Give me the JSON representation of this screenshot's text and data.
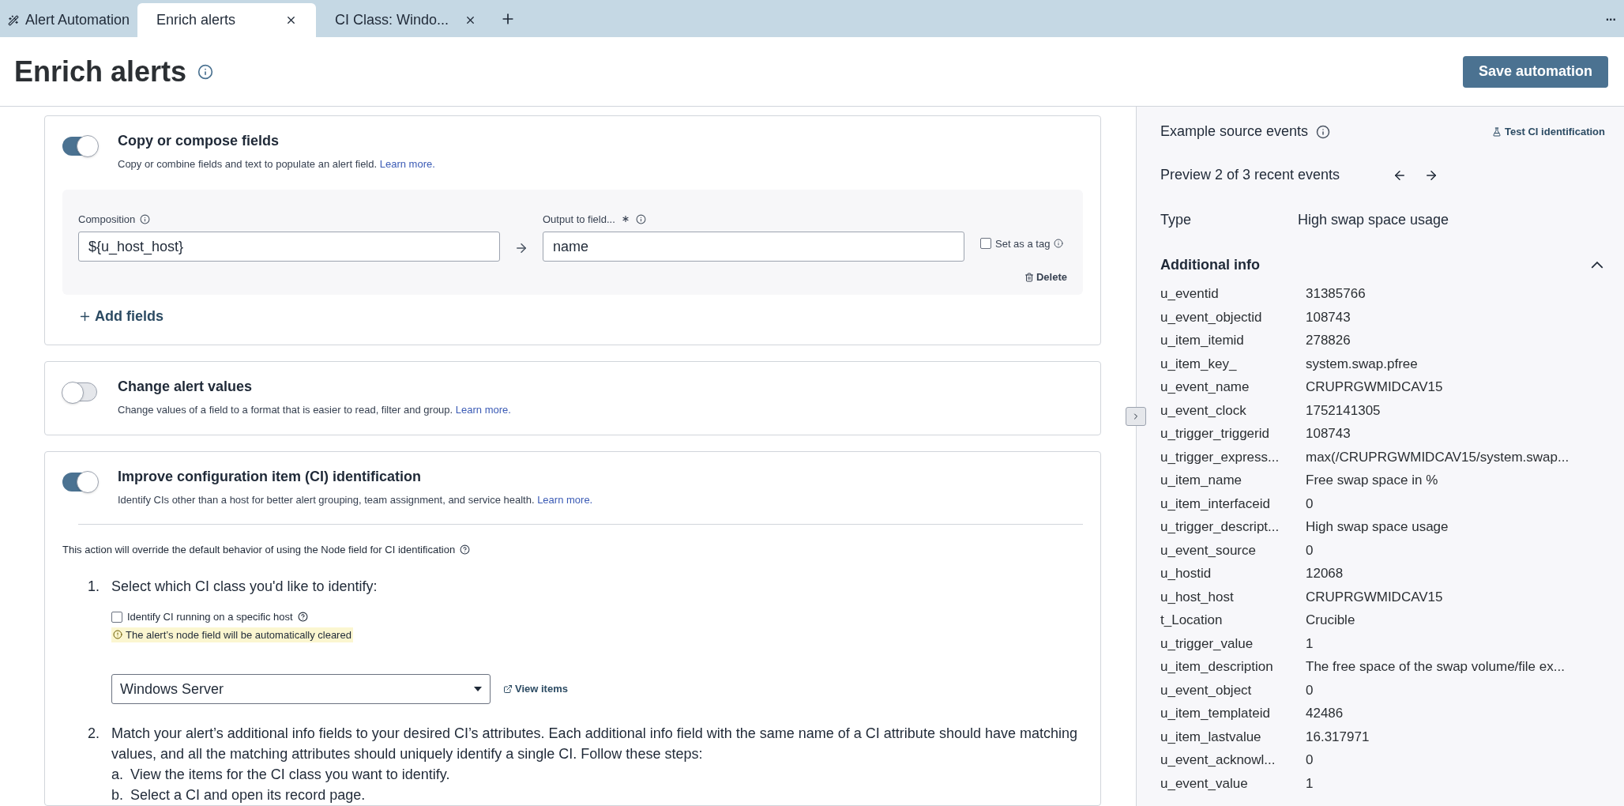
{
  "tabs": [
    {
      "label": "Alert Automation",
      "selected": false,
      "closable": false,
      "kind": "home"
    },
    {
      "label": "Enrich alerts",
      "selected": true,
      "closable": true,
      "kind": "page"
    },
    {
      "label": "CI Class: Windo...",
      "selected": false,
      "closable": true,
      "kind": "page"
    }
  ],
  "more_menu": "...",
  "header": {
    "title": "Enrich alerts",
    "save_button": "Save automation"
  },
  "sections": [
    {
      "kind": "copy",
      "title": "Copy or compose fields",
      "on": true,
      "description": "Copy or combine fields and text to populate an alert field.",
      "link": "Learn more.",
      "composition": {
        "label": "Composition",
        "value": "${u_host_host}"
      },
      "output": {
        "label": "Output to field...",
        "value": "name"
      },
      "tag": {
        "label": "Set as a tag",
        "checked": false
      },
      "delete": "Delete",
      "add": "Add fields"
    },
    {
      "kind": "simple",
      "title": "Change alert values",
      "on": false,
      "description": "Change values of a field to a format that is easier to read, filter and group.",
      "link": "Learn more."
    },
    {
      "kind": "ci",
      "title": "Improve configuration item (CI) identification",
      "on": true,
      "description": "Identify CIs other than a host for better alert grouping, team assignment, and service health.",
      "link": "Learn more.",
      "note": "This action will override the default behavior of using the Node field for CI identification",
      "steps": [
        {
          "marker": "1.",
          "text": "Select which CI class you'd like to identify:",
          "host_option": {
            "label": "Identify CI running on a specific host",
            "checked": false
          },
          "warning": "The alert’s node field will be automatically cleared",
          "select": {
            "value": "Windows Server"
          },
          "view_items": "View items"
        },
        {
          "marker": "2.",
          "text": "Match your alert’s additional info fields to your desired CI’s attributes. Each additional info field with the same name of a CI attribute should have matching values, and all the matching attributes should uniquely identify a single CI. Follow these steps:",
          "substeps": [
            {
              "marker": "a.",
              "text": "View the items for the CI class you want to identify."
            },
            {
              "marker": "b.",
              "text": "Select a CI and open its record page."
            }
          ]
        }
      ]
    }
  ],
  "side_panel": {
    "title": "Example source events",
    "test_link": "Test CI identification",
    "preview": "Preview 2 of 3 recent events",
    "type_label": "Type",
    "type_value": "High swap space usage",
    "additional_title": "Additional info",
    "expanded": true,
    "rows": [
      {
        "key": "u_eventid",
        "value": "31385766"
      },
      {
        "key": "u_event_objectid",
        "value": "108743"
      },
      {
        "key": "u_item_itemid",
        "value": "278826"
      },
      {
        "key": "u_item_key_",
        "value": "system.swap.pfree"
      },
      {
        "key": "u_event_name",
        "value": "CRUPRGWMIDCAV15"
      },
      {
        "key": "u_event_clock",
        "value": "1752141305"
      },
      {
        "key": "u_trigger_triggerid",
        "value": "108743"
      },
      {
        "key": "u_trigger_express...",
        "value": "max(/CRUPRGWMIDCAV15/system.swap..."
      },
      {
        "key": "u_item_name",
        "value": "Free swap space in %"
      },
      {
        "key": "u_item_interfaceid",
        "value": "0"
      },
      {
        "key": "u_trigger_descript...",
        "value": "High swap space usage"
      },
      {
        "key": "u_event_source",
        "value": "0"
      },
      {
        "key": "u_hostid",
        "value": "12068"
      },
      {
        "key": "u_host_host",
        "value": "CRUPRGWMIDCAV15"
      },
      {
        "key": "t_Location",
        "value": "Crucible"
      },
      {
        "key": "u_trigger_value",
        "value": "1"
      },
      {
        "key": "u_item_description",
        "value": "The free space of the swap volume/file ex..."
      },
      {
        "key": "u_event_object",
        "value": "0"
      },
      {
        "key": "u_item_templateid",
        "value": "42486"
      },
      {
        "key": "u_item_lastvalue",
        "value": "16.317971"
      },
      {
        "key": "u_event_acknowl...",
        "value": "0"
      },
      {
        "key": "u_event_value",
        "value": "1"
      }
    ]
  }
}
